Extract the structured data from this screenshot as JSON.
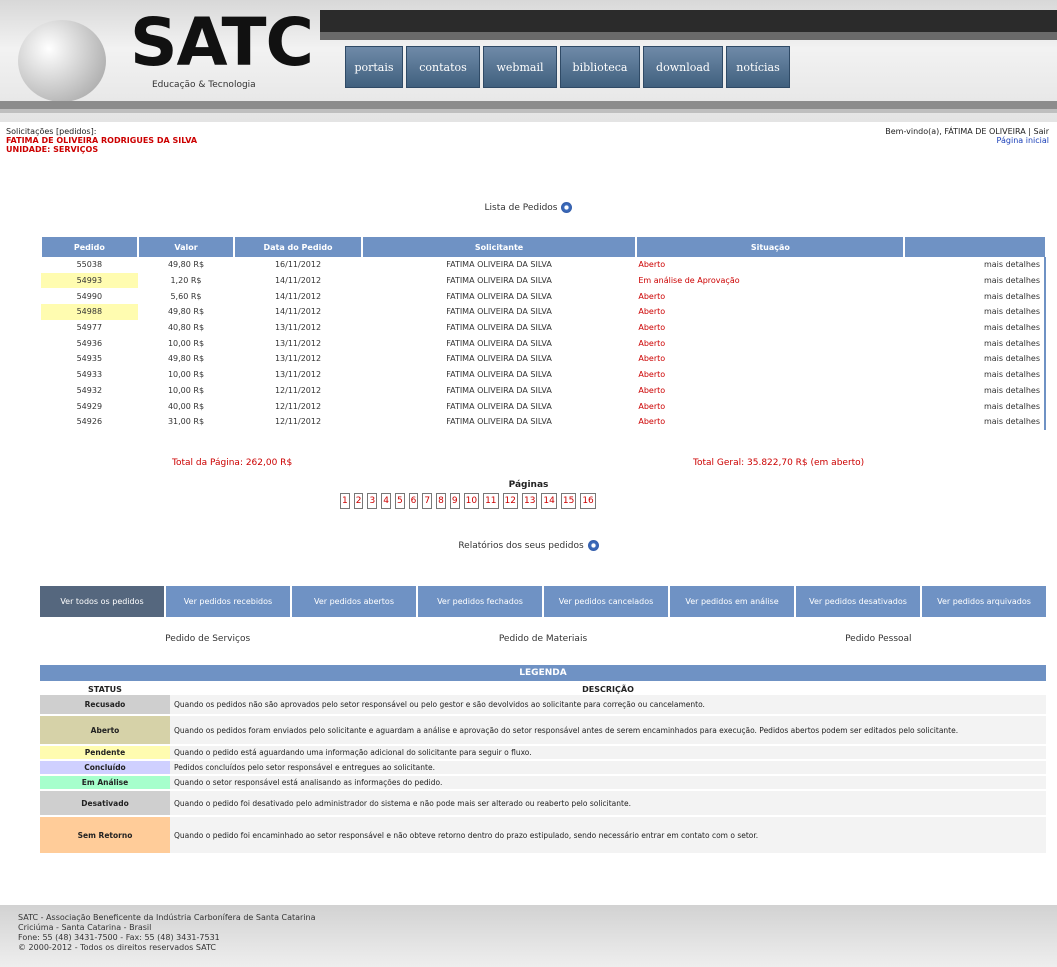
{
  "header": {
    "logo_text": "SATC",
    "logo_subtitle": "Educação & Tecnologia",
    "nav": [
      {
        "label": "portais",
        "w": 58
      },
      {
        "label": "contatos",
        "w": 74
      },
      {
        "label": "webmail",
        "w": 74
      },
      {
        "label": "biblioteca",
        "w": 80
      },
      {
        "label": "download",
        "w": 80
      },
      {
        "label": "notícias",
        "w": 64
      }
    ]
  },
  "user": {
    "line1": "Solicitações [pedidos]:",
    "line2": "FATIMA DE OLIVEIRA RODRIGUES DA SILVA",
    "line3": "UNIDADE: SERVIÇOS"
  },
  "session": {
    "line1": "Bem-vindo(a), FÁTIMA DE OLIVEIRA | Sair",
    "line2": "Página inicial"
  },
  "orders": {
    "heading": "Lista de Pedidos",
    "columns": [
      "Pedido",
      "Valor",
      "Data do Pedido",
      "Solicitante",
      "Situação",
      ""
    ],
    "rows": [
      {
        "id": "55038",
        "value": "49,80 R$",
        "date": "16/11/2012",
        "requester": "FATIMA OLIVEIRA DA SILVA",
        "status": "Aberto",
        "details": "mais detalhes",
        "hl": false
      },
      {
        "id": "54993",
        "value": "1,20 R$",
        "date": "14/11/2012",
        "requester": "FATIMA OLIVEIRA DA SILVA",
        "status": "Em análise de Aprovação",
        "details": "mais detalhes",
        "hl": true
      },
      {
        "id": "54990",
        "value": "5,60 R$",
        "date": "14/11/2012",
        "requester": "FATIMA OLIVEIRA DA SILVA",
        "status": "Aberto",
        "details": "mais detalhes",
        "hl": false
      },
      {
        "id": "54988",
        "value": "49,80 R$",
        "date": "14/11/2012",
        "requester": "FATIMA OLIVEIRA DA SILVA",
        "status": "Aberto",
        "details": "mais detalhes",
        "hl": true
      },
      {
        "id": "54977",
        "value": "40,80 R$",
        "date": "13/11/2012",
        "requester": "FATIMA OLIVEIRA DA SILVA",
        "status": "Aberto",
        "details": "mais detalhes",
        "hl": false
      },
      {
        "id": "54936",
        "value": "10,00 R$",
        "date": "13/11/2012",
        "requester": "FATIMA OLIVEIRA DA SILVA",
        "status": "Aberto",
        "details": "mais detalhes",
        "hl": false
      },
      {
        "id": "54935",
        "value": "49,80 R$",
        "date": "13/11/2012",
        "requester": "FATIMA OLIVEIRA DA SILVA",
        "status": "Aberto",
        "details": "mais detalhes",
        "hl": false
      },
      {
        "id": "54933",
        "value": "10,00 R$",
        "date": "13/11/2012",
        "requester": "FATIMA OLIVEIRA DA SILVA",
        "status": "Aberto",
        "details": "mais detalhes",
        "hl": false
      },
      {
        "id": "54932",
        "value": "10,00 R$",
        "date": "12/11/2012",
        "requester": "FATIMA OLIVEIRA DA SILVA",
        "status": "Aberto",
        "details": "mais detalhes",
        "hl": false
      },
      {
        "id": "54929",
        "value": "40,00 R$",
        "date": "12/11/2012",
        "requester": "FATIMA OLIVEIRA DA SILVA",
        "status": "Aberto",
        "details": "mais detalhes",
        "hl": false
      },
      {
        "id": "54926",
        "value": "31,00 R$",
        "date": "12/11/2012",
        "requester": "FATIMA OLIVEIRA DA SILVA",
        "status": "Aberto",
        "details": "mais detalhes",
        "hl": false
      }
    ],
    "total_left": "Total da Página: 262,00 R$",
    "total_right": "Total Geral: 35.822,70 R$ (em aberto)",
    "pages_label": "Páginas",
    "pages": [
      "1",
      "2",
      "3",
      "4",
      "5",
      "6",
      "7",
      "8",
      "9",
      "10",
      "11",
      "12",
      "13",
      "14",
      "15",
      "16"
    ]
  },
  "reports_heading": "Relatórios dos seus pedidos",
  "filters": [
    "Ver todos os pedidos",
    "Ver pedidos recebidos",
    "Ver pedidos abertos",
    "Ver pedidos fechados",
    "Ver pedidos cancelados",
    "Ver pedidos em análise",
    "Ver pedidos desativados",
    "Ver pedidos arquivados"
  ],
  "sub_actions": [
    "Pedido de Serviços",
    "Pedido de Materiais",
    "Pedido Pessoal"
  ],
  "legend": {
    "title": "LEGENDA",
    "col_status": "STATUS",
    "col_desc": "DESCRIÇÃO",
    "items": [
      {
        "label": "Recusado",
        "color": "#cfcfcf",
        "text": "Quando os pedidos não são aprovados pelo setor responsável ou pelo gestor e são devolvidos ao solicitante para correção ou cancelamento."
      },
      {
        "label": "Aberto",
        "color": "#d6d2a8",
        "text": "Quando os pedidos foram enviados pelo solicitante e aguardam a análise e aprovação do setor responsável antes de serem encaminhados para execução. Pedidos abertos podem ser editados pelo solicitante."
      },
      {
        "label": "Pendente",
        "color": "#fffcb0",
        "text": "Quando o pedido está aguardando uma informação adicional do solicitante para seguir o fluxo."
      },
      {
        "label": "Concluído",
        "color": "#cfd0ff",
        "text": "Pedidos concluídos pelo setor responsável e entregues ao solicitante."
      },
      {
        "label": "Em Análise",
        "color": "#a6ffcc",
        "text": "Quando o setor responsável está analisando as informações do pedido."
      },
      {
        "label": "Desativado",
        "color": "#cfcfcf",
        "text": "Quando o pedido foi desativado pelo administrador do sistema e não pode mais ser alterado ou reaberto pelo solicitante."
      },
      {
        "label": "Sem Retorno",
        "color": "#ffcc99",
        "text": "Quando o pedido foi encaminhado ao setor responsável e não obteve retorno dentro do prazo estipulado, sendo necessário entrar em contato com o setor."
      }
    ]
  },
  "footer": {
    "line1": "SATC - Associação Beneficente da Indústria Carbonífera de Santa Catarina",
    "line2": "Criciúma - Santa Catarina - Brasil",
    "line3": "Fone: 55 (48) 3431-7500 - Fax: 55 (48) 3431-7531",
    "line4": "© 2000-2012 - Todos os direitos reservados SATC"
  }
}
